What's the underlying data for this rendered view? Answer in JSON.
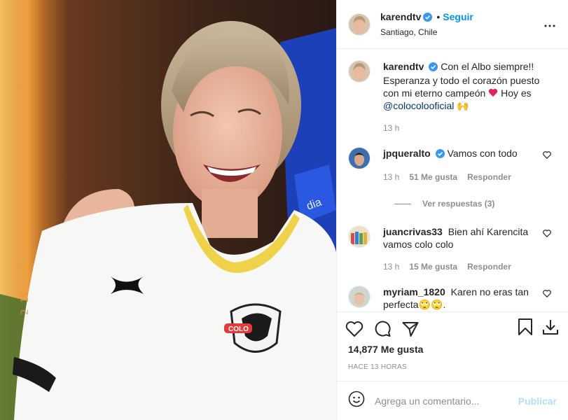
{
  "post": {
    "author": "karendtv",
    "follow_label": "Seguir",
    "location": "Santiago, Chile"
  },
  "caption": {
    "user": "karendtv",
    "text": "Con el Albo siempre!! Esperanza y todo el corazón puesto con mi eterno campeón",
    "text_after": "Hoy es",
    "mention": "@colocolooficial",
    "time": "13 h"
  },
  "comments": [
    {
      "user": "jpqueralto",
      "verified": true,
      "text": "Vamos con todo",
      "time": "13 h",
      "likes": "51 Me gusta",
      "reply": "Responder",
      "view_replies": "Ver respuestas (3)"
    },
    {
      "user": "juancrivas33",
      "verified": false,
      "text": "Bien ahí Karencita vamos colo colo",
      "time": "13 h",
      "likes": "15 Me gusta",
      "reply": "Responder"
    },
    {
      "user": "myriam_1820",
      "verified": false,
      "text": "Karen no eras tan perfecta🙄🙄."
    }
  ],
  "likes_text": "14,877 Me gusta",
  "post_time": "HACE 13 HORAS",
  "add_comment": {
    "placeholder": "Agrega un comentario...",
    "post_label": "Publicar"
  },
  "colors": {
    "link": "#0095f6",
    "muted": "#8e8e8e",
    "mention": "#00376b",
    "publish_disabled": "#b2dffc"
  }
}
